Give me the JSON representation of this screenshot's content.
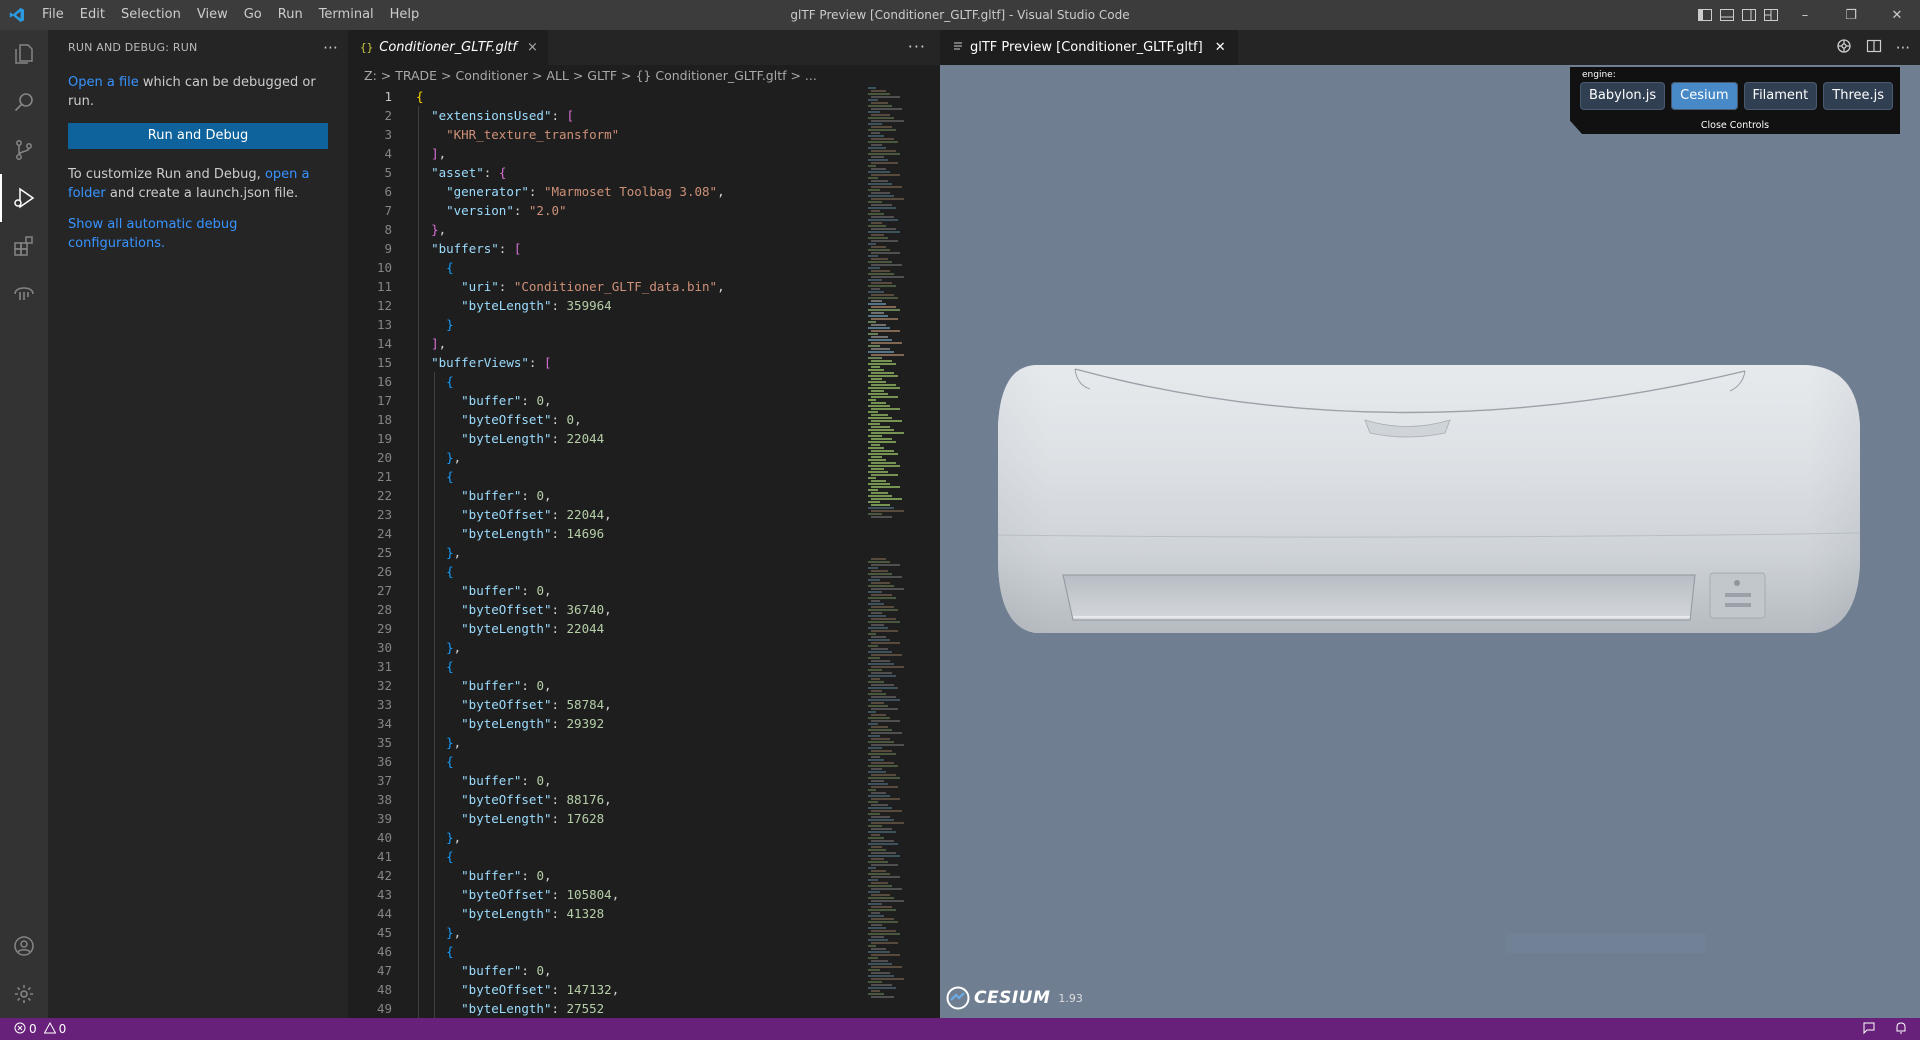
{
  "window": {
    "title": "glTF Preview [Conditioner_GLTF.gltf] - Visual Studio Code",
    "menu": [
      "File",
      "Edit",
      "Selection",
      "View",
      "Go",
      "Run",
      "Terminal",
      "Help"
    ],
    "controls": {
      "minimize": "–",
      "maximize": "❐",
      "close": "✕"
    }
  },
  "activity_bar": {
    "items": [
      {
        "icon": "files-icon"
      },
      {
        "icon": "search-icon"
      },
      {
        "icon": "source-control-icon"
      },
      {
        "icon": "run-debug-icon",
        "active": true
      },
      {
        "icon": "extensions-icon"
      },
      {
        "icon": "testing-icon"
      }
    ],
    "bottom": [
      {
        "icon": "account-icon"
      },
      {
        "icon": "settings-gear-icon"
      }
    ]
  },
  "sidebar": {
    "header": "RUN AND DEBUG: RUN",
    "more": "···",
    "open_file_link": "Open a file",
    "open_file_rest": " which can be debugged or run.",
    "run_button": "Run and Debug",
    "customize_text": "To customize Run and Debug, ",
    "open_folder_link": "open a folder",
    "customize_rest": " and create a launch.json file.",
    "show_all_link": "Show all automatic debug configurations."
  },
  "editor": {
    "tab": {
      "icon_text": "{}",
      "label": "Conditioner_GLTF.gltf",
      "close": "×"
    },
    "more": "···",
    "breadcrumb": "Z: > TRADE > Conditioner > ALL > GLTF > {} Conditioner_GLTF.gltf > ...",
    "code_lines": [
      "{",
      "  \"extensionsUsed\": [",
      "    \"KHR_texture_transform\"",
      "  ],",
      "  \"asset\": {",
      "    \"generator\": \"Marmoset Toolbag 3.08\",",
      "    \"version\": \"2.0\"",
      "  },",
      "  \"buffers\": [",
      "    {",
      "      \"uri\": \"Conditioner_GLTF_data.bin\",",
      "      \"byteLength\": 359964",
      "    }",
      "  ],",
      "  \"bufferViews\": [",
      "    {",
      "      \"buffer\": 0,",
      "      \"byteOffset\": 0,",
      "      \"byteLength\": 22044",
      "    },",
      "    {",
      "      \"buffer\": 0,",
      "      \"byteOffset\": 22044,",
      "      \"byteLength\": 14696",
      "    },",
      "    {",
      "      \"buffer\": 0,",
      "      \"byteOffset\": 36740,",
      "      \"byteLength\": 22044",
      "    },",
      "    {",
      "      \"buffer\": 0,",
      "      \"byteOffset\": 58784,",
      "      \"byteLength\": 29392",
      "    },",
      "    {",
      "      \"buffer\": 0,",
      "      \"byteOffset\": 88176,",
      "      \"byteLength\": 17628",
      "    },",
      "    {",
      "      \"buffer\": 0,",
      "      \"byteOffset\": 105804,",
      "      \"byteLength\": 41328",
      "    },",
      "    {",
      "      \"buffer\": 0,",
      "      \"byteOffset\": 147132,",
      "      \"byteLength\": 27552"
    ],
    "current_line": 1
  },
  "preview": {
    "tab": {
      "label": "glTF Preview [Conditioner_GLTF.gltf]",
      "close": "✕"
    },
    "engine_label": "engine:",
    "engines": [
      {
        "label": "Babylon.js",
        "selected": false
      },
      {
        "label": "Cesium",
        "selected": true
      },
      {
        "label": "Filament",
        "selected": false
      },
      {
        "label": "Three.js",
        "selected": false
      }
    ],
    "close_controls": "Close Controls",
    "cesium_logo": "CESIUM",
    "cesium_version": "1.93"
  },
  "statusbar": {
    "errors": "0",
    "warnings": "0"
  },
  "colors": {
    "statusbar": "#68217a",
    "accent": "#0e639c",
    "link": "#3794ff",
    "viewport": "#6f7e91"
  }
}
